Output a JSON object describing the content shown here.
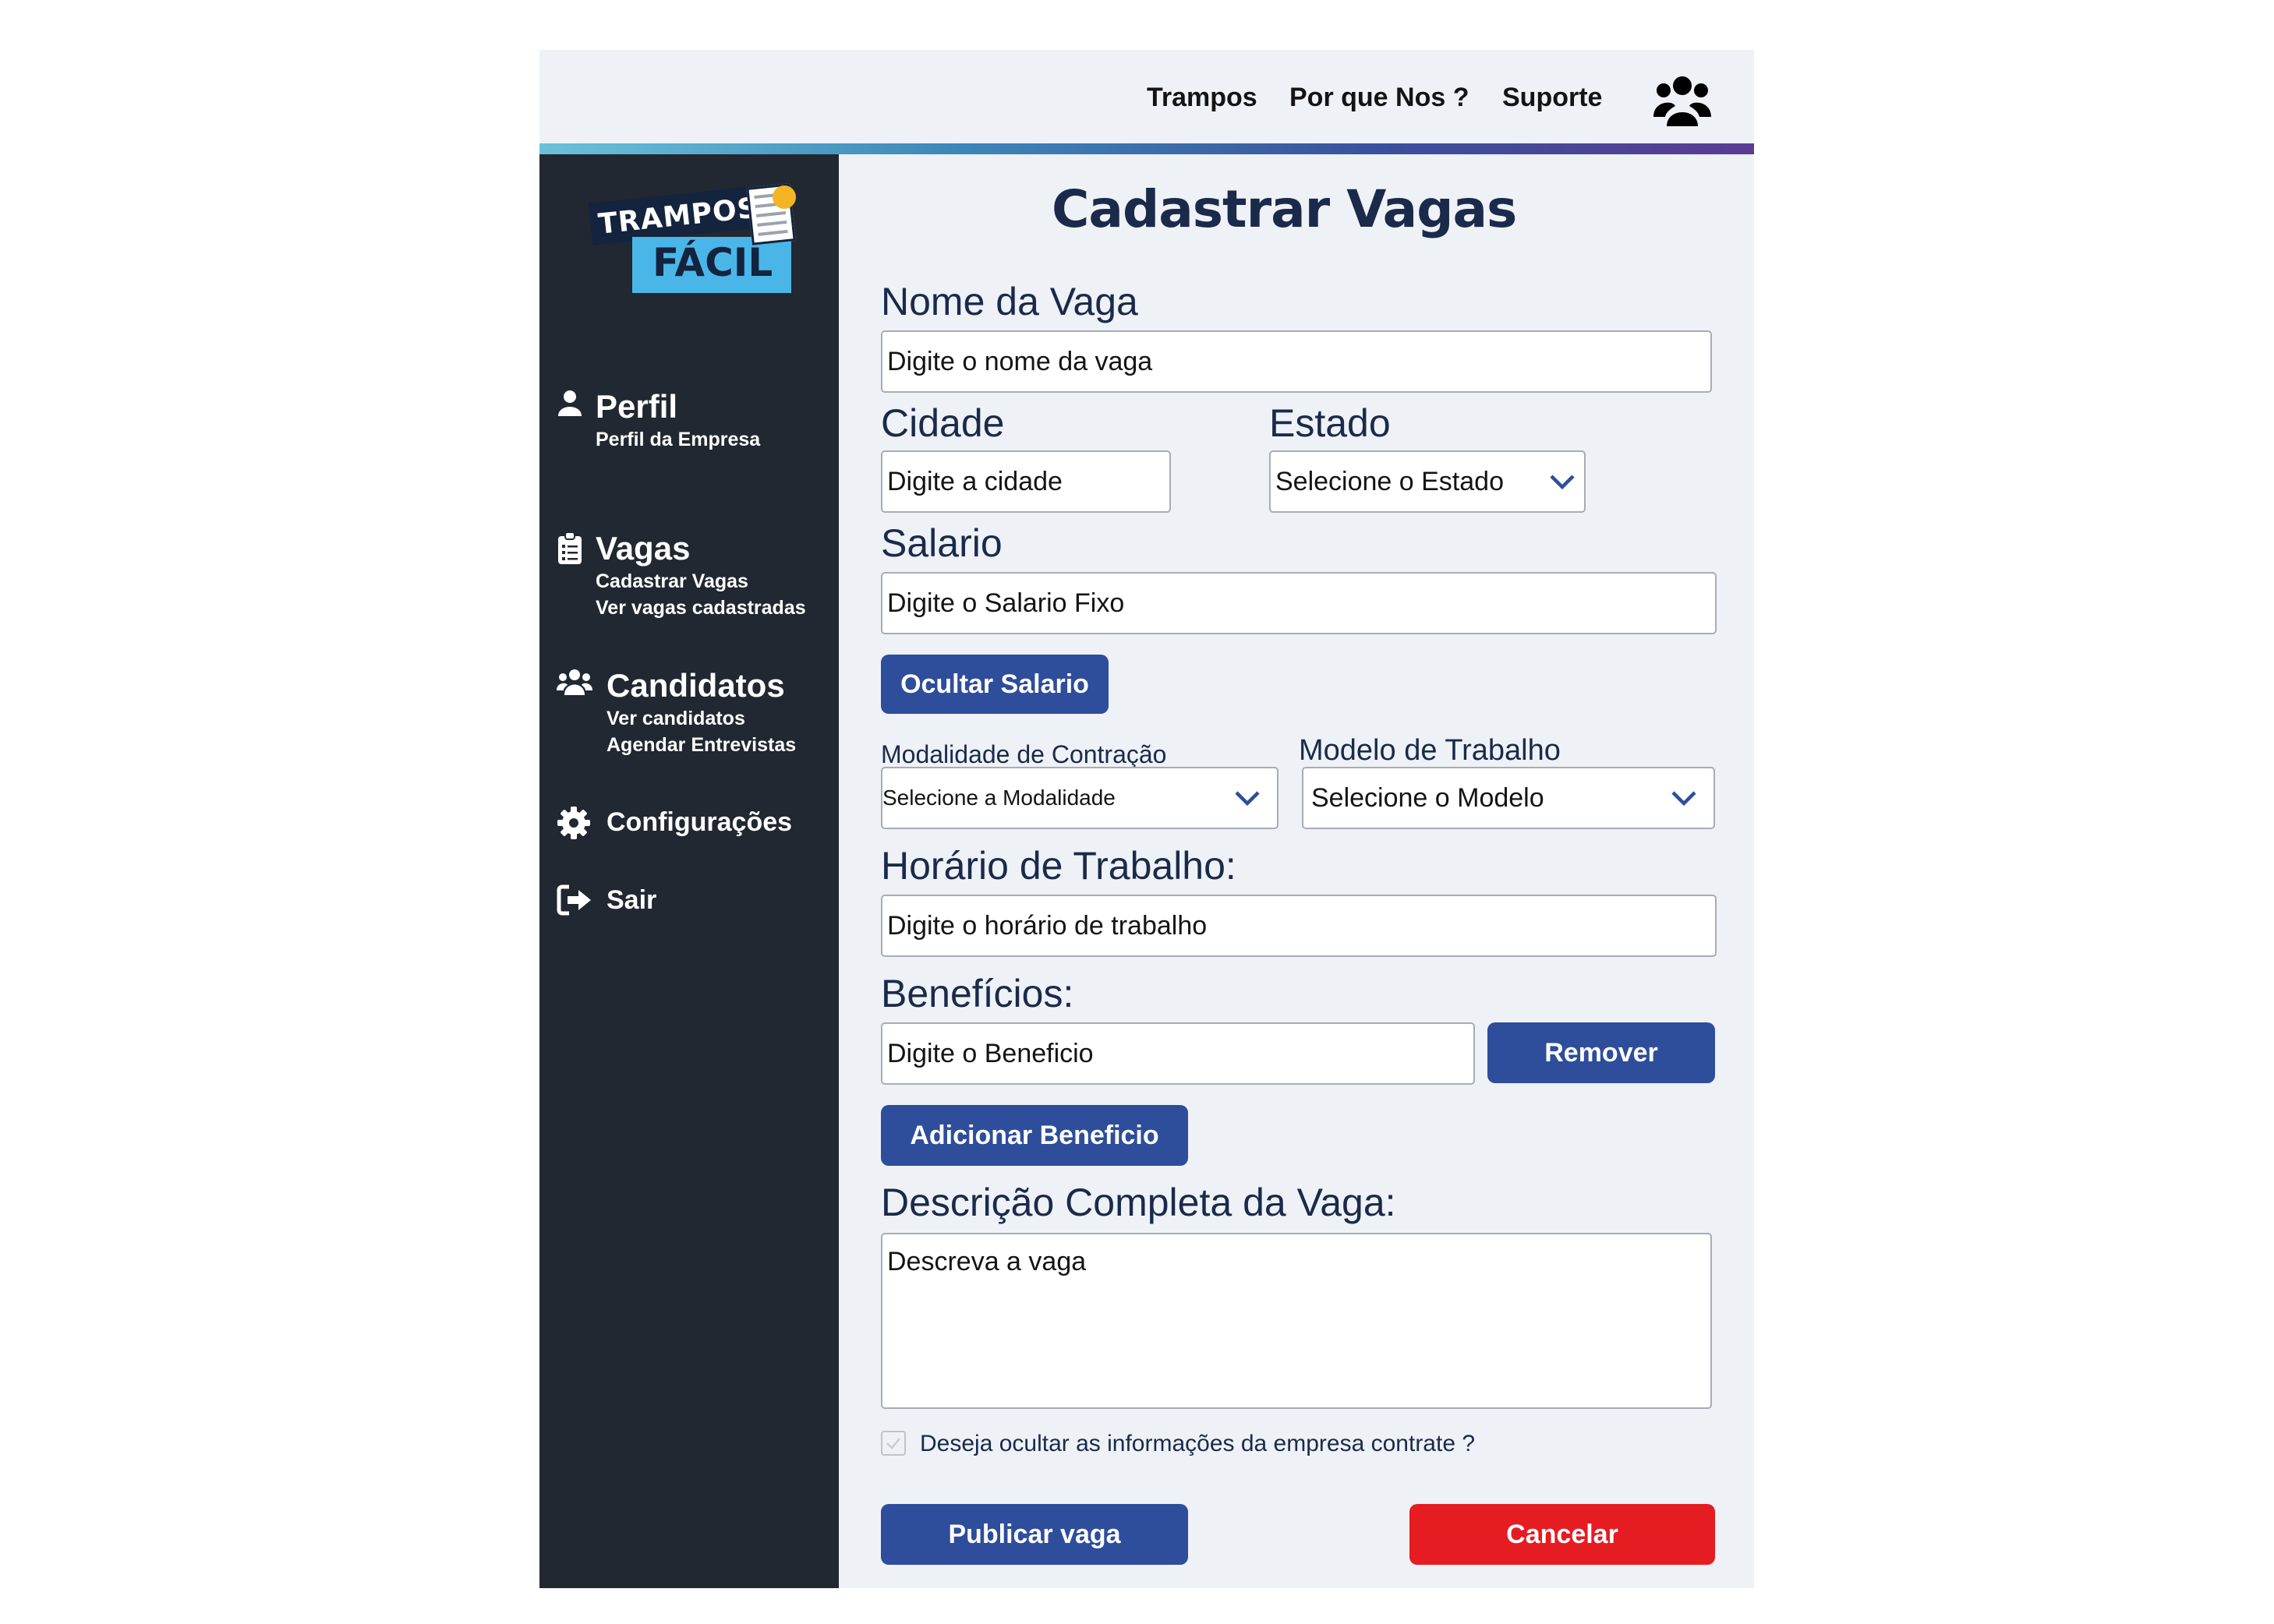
{
  "header": {
    "nav": [
      "Trampos",
      "Por que Nos ?",
      "Suporte"
    ],
    "user_icon": "users-icon"
  },
  "logo": {
    "line1": "TRAMPOS",
    "line2": "FÁCIL"
  },
  "sidebar": {
    "perfil": {
      "title": "Perfil",
      "icon": "user-icon",
      "subs": [
        "Perfil da Empresa"
      ]
    },
    "vagas": {
      "title": "Vagas",
      "icon": "clipboard-icon",
      "subs": [
        "Cadastrar Vagas",
        "Ver vagas cadastradas"
      ]
    },
    "candidatos": {
      "title": "Candidatos",
      "icon": "users-icon",
      "subs": [
        "Ver candidatos",
        "Agendar Entrevistas"
      ]
    },
    "configuracoes": {
      "label": "Configurações",
      "icon": "gear-icon"
    },
    "sair": {
      "label": "Sair",
      "icon": "sign-out-icon"
    }
  },
  "form": {
    "title": "Cadastrar Vagas",
    "nome": {
      "label": "Nome da Vaga",
      "placeholder": "Digite o nome da vaga"
    },
    "cidade": {
      "label": "Cidade",
      "placeholder": "Digite  a cidade"
    },
    "estado": {
      "label": "Estado",
      "selected": "Selecione o Estado"
    },
    "salario": {
      "label": "Salario",
      "placeholder": "Digite o Salario Fixo"
    },
    "ocultar_salario": "Ocultar Salario",
    "modalidade": {
      "label": "Modalidade de Contração",
      "selected": "Selecione a Modalidade"
    },
    "modelo": {
      "label": "Modelo de Trabalho",
      "selected": "Selecione o Modelo"
    },
    "horario": {
      "label": "Horário de Trabalho:",
      "placeholder": "Digite o horário de trabalho"
    },
    "beneficios": {
      "label": "Benefícios:",
      "placeholder": "Digite o Beneficio",
      "remove": "Remover",
      "add": "Adicionar Beneficio"
    },
    "descricao": {
      "label": "Descrição Completa da Vaga:",
      "placeholder": "Descreva a vaga"
    },
    "ocultar_empresa": {
      "label": "Deseja ocultar as informações da empresa contrate ?",
      "checked": false
    },
    "publicar": "Publicar vaga",
    "cancelar": "Cancelar"
  },
  "colors": {
    "sidebar": "#212831",
    "primary": "#2e4d9b",
    "danger": "#e51c22",
    "text": "#1b2a4a",
    "page": "#eef1f6"
  }
}
